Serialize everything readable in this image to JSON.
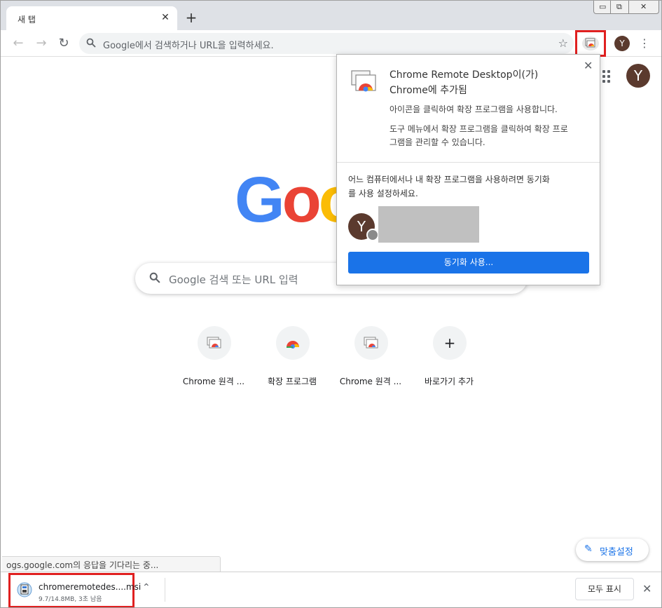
{
  "tab": {
    "title": "새 탭"
  },
  "window_controls": {
    "minimize": "▭",
    "maximize": "⧉",
    "close": "✕"
  },
  "toolbar": {
    "back": "←",
    "forward": "→",
    "reload": "↻",
    "omnibox_placeholder": "Google에서 검색하거나 URL을 입력하세요.",
    "avatar_letter": "Y",
    "menu": "⋮"
  },
  "ntp": {
    "avatar_letter": "Y",
    "logo_letters": [
      "G",
      "o",
      "o"
    ],
    "logo_colors": [
      "#4285f4",
      "#ea4335",
      "#fbbc05"
    ],
    "search_placeholder": "Google 검색 또는 URL 입력",
    "tiles": [
      {
        "label": "Chrome 원격 ...",
        "icon": "remote-desktop-icon"
      },
      {
        "label": "확장 프로그램",
        "icon": "chrome-icon"
      },
      {
        "label": "Chrome 원격 ...",
        "icon": "remote-desktop-icon"
      },
      {
        "label": "바로가기 추가",
        "icon": "plus-icon"
      }
    ],
    "add_symbol": "+",
    "customize_label": "맞춤설정",
    "status_text": "ogs.google.com의 응답을 기다리는 중..."
  },
  "popup": {
    "title_line1": "Chrome Remote Desktop이(가)",
    "title_line2": "Chrome에 추가됨",
    "info1": "아이콘을 클릭하여 확장 프로그램을 사용합니다.",
    "info2": "도구 메뉴에서 확장 프로그램을 클릭하여 확장 프로",
    "info3": "그램을 관리할 수 있습니다.",
    "sync_text1": "어느 컴퓨터에서나 내 확장 프로그램을 사용하려면 동기화",
    "sync_text2": "를 사용 설정하세요.",
    "avatar_letter": "Y",
    "sync_button": "동기화 사용..."
  },
  "downloads": {
    "file_name": "chromeremotedes....msi",
    "progress_text": "9.7/14.8MB, 3초 남음",
    "progress_fraction": 0.655,
    "show_all": "모두 표시"
  },
  "colors": {
    "accent": "#1a73e8",
    "highlight": "#e02020",
    "avatar": "#5b3a2e"
  }
}
